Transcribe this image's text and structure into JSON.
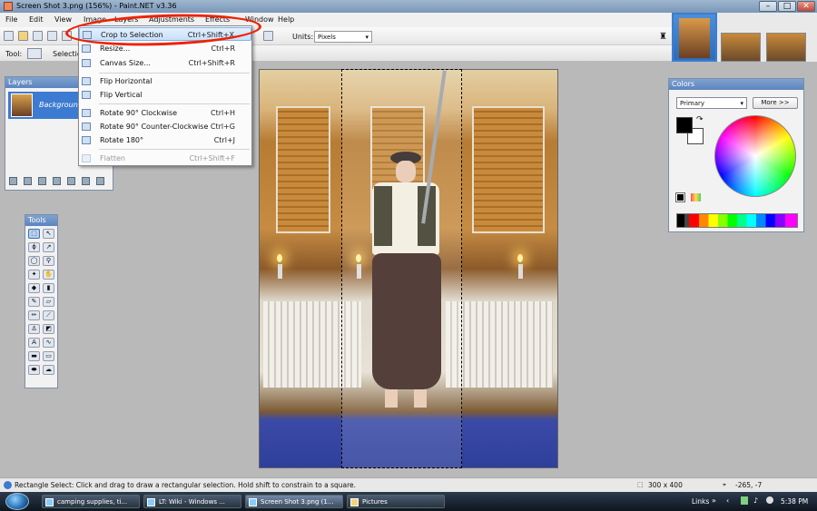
{
  "window": {
    "title": "Screen Shot 3.png (156%) - Paint.NET v3.36"
  },
  "menu": [
    "File",
    "Edit",
    "View",
    "Image",
    "Layers",
    "Adjustments",
    "Effects",
    "Window",
    "Help"
  ],
  "toolbar": {
    "tool_label": "Tool:",
    "selection_label": "Selection",
    "units_label": "Units:",
    "units_value": "Pixels"
  },
  "image_menu": {
    "items": [
      {
        "label": "Crop to Selection",
        "shortcut": "Ctrl+Shift+X",
        "icon": "crop-icon",
        "highlighted": true
      },
      {
        "label": "Resize...",
        "shortcut": "Ctrl+R",
        "icon": "resize-icon"
      },
      {
        "label": "Canvas Size...",
        "shortcut": "Ctrl+Shift+R",
        "icon": "canvas-size-icon"
      },
      {
        "label": "Flip Horizontal",
        "shortcut": "",
        "icon": "flip-horizontal-icon"
      },
      {
        "label": "Flip Vertical",
        "shortcut": "",
        "icon": "flip-vertical-icon"
      },
      {
        "label": "Rotate 90° Clockwise",
        "shortcut": "Ctrl+H",
        "icon": "rotate-cw-icon"
      },
      {
        "label": "Rotate 90° Counter-Clockwise",
        "shortcut": "Ctrl+G",
        "icon": "rotate-ccw-icon"
      },
      {
        "label": "Rotate 180°",
        "shortcut": "Ctrl+J",
        "icon": "rotate-180-icon"
      },
      {
        "label": "Flatten",
        "shortcut": "Ctrl+Shift+F",
        "icon": "flatten-icon",
        "disabled": true
      }
    ]
  },
  "layers_panel": {
    "title": "Layers",
    "layer_name": "Background"
  },
  "tools_panel": {
    "title": "Tools"
  },
  "colors_panel": {
    "title": "Colors",
    "mode": "Primary",
    "more_button": "More >>"
  },
  "status": {
    "text": "Rectangle Select: Click and drag to draw a rectangular selection. Hold shift to constrain to a square.",
    "image_size": "300 x 400",
    "cursor_pos": "-265, -7"
  },
  "taskbar": {
    "tasks": [
      "camping supplies, ti...",
      "LT: Wiki - Windows ...",
      "Screen Shot 3.png (1...",
      "Pictures"
    ],
    "links_label": "Links",
    "clock": "5:38 PM"
  },
  "colors": {
    "highlight_ring": "#e02000",
    "accent": "#3d7ad1"
  }
}
